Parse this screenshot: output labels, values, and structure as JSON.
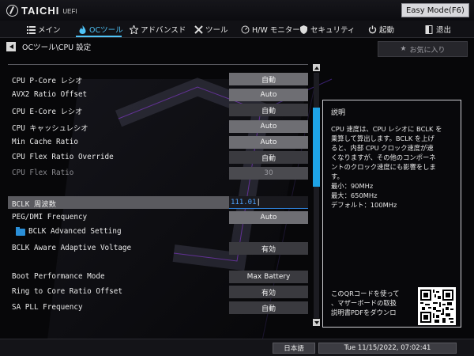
{
  "header": {
    "brand": "TAICHI",
    "brand_sub": "UEFI",
    "mode_button": "Easy Mode(F6)"
  },
  "nav": {
    "items": [
      {
        "label": "メイン",
        "icon": "list-icon"
      },
      {
        "label": "OCツール",
        "icon": "flame-icon"
      },
      {
        "label": "アドバンスド",
        "icon": "star-icon"
      },
      {
        "label": "ツール",
        "icon": "tools-icon"
      },
      {
        "label": "H/W モニター",
        "icon": "monitor-icon"
      },
      {
        "label": "セキュリティ",
        "icon": "shield-icon"
      },
      {
        "label": "起動",
        "icon": "power-icon"
      },
      {
        "label": "退出",
        "icon": "exit-icon"
      }
    ],
    "active_index": 1
  },
  "breadcrumb": "OCツール\\CPU 設定",
  "favorite_button": "お気に入り",
  "settings": [
    {
      "label": "CPU P-Core レシオ",
      "value": "自動"
    },
    {
      "label": "AVX2 Ratio Offset",
      "value": "Auto"
    },
    {
      "label": "CPU E-Core レシオ",
      "value": "自動"
    },
    {
      "label": "CPU  キャッシュレシオ",
      "value": "Auto"
    },
    {
      "label": "Min Cache  Ratio",
      "value": "Auto"
    },
    {
      "label": "CPU Flex   Ratio Override",
      "value": "自動"
    },
    {
      "label": "CPU Flex   Ratio",
      "value": "30"
    },
    {
      "label": "BCLK 周波数",
      "value": "111.01"
    },
    {
      "label": "PEG/DMI Frequency",
      "value": "Auto"
    },
    {
      "label": "BCLK Advanced Setting",
      "value": ""
    },
    {
      "label": "BCLK Aware Adaptive Voltage",
      "value": "有効"
    },
    {
      "label": "Boot Performance Mode",
      "value": "Max Battery"
    },
    {
      "label": "Ring to Core Ratio Offset",
      "value": "有効"
    },
    {
      "label": "SA PLL Frequency",
      "value": "自動"
    }
  ],
  "description": {
    "title": "説明",
    "lines": [
      "CPU 速度は、CPU レシオに BCLK を",
      "乗算して算出します。BCLK を上げ",
      "ると、内部 CPU クロック速度が速",
      "くなりますが、その他のコンポーネ",
      "ントのクロック速度にも影響をしま",
      "す。",
      "最小：90MHz",
      "最大：650MHz",
      "デフォルト：100MHz"
    ],
    "qr_lines": [
      "このQRコードを使って",
      "、マザーボードの取扱",
      "説明書PDFをダウンロ"
    ]
  },
  "footer": {
    "language": "日本語",
    "datetime": "Tue 11/15/2022, 07:02:41"
  },
  "colors": {
    "accent": "#1ea3e6",
    "value_bg": "#6e6e73",
    "selected_bg": "#5a5a5f"
  }
}
